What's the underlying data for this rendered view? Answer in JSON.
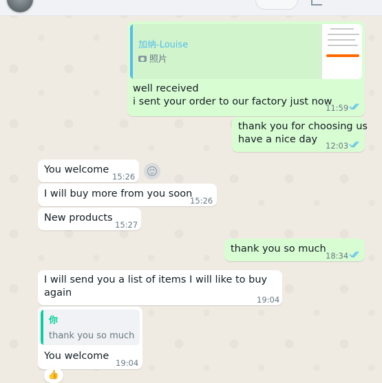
{
  "messages": [
    {
      "id": "m1",
      "direction": "out",
      "quote": {
        "author": "加纳-Louise",
        "subtitle": "照片"
      },
      "lines": [
        "well received",
        "i sent your order to our factory just now"
      ],
      "time": "11:59",
      "read": true
    },
    {
      "id": "m2",
      "direction": "out",
      "lines": [
        "thank you for choosing us",
        "have a nice day"
      ],
      "time": "12:03",
      "read": true
    },
    {
      "id": "m3",
      "direction": "in",
      "lines": [
        "You welcome"
      ],
      "time": "15:26"
    },
    {
      "id": "m4",
      "direction": "in",
      "lines": [
        "I will buy more from you soon"
      ],
      "time": "15:26"
    },
    {
      "id": "m5",
      "direction": "in",
      "lines": [
        "New products"
      ],
      "time": "15:27"
    },
    {
      "id": "m6",
      "direction": "out",
      "lines": [
        "thank you so much"
      ],
      "time": "18:34",
      "read": true
    },
    {
      "id": "m7",
      "direction": "in",
      "lines": [
        "I will send you a list of items I will like to buy",
        "again"
      ],
      "time": "19:04"
    },
    {
      "id": "m8",
      "direction": "in",
      "quote": {
        "author": "你",
        "text": "thank you so much"
      },
      "lines": [
        "You welcome"
      ],
      "time": "19:04",
      "reaction": "👍"
    }
  ],
  "colors": {
    "outgoing_bubble": "#d9fdd3",
    "incoming_bubble": "#ffffff",
    "chat_background": "#efeae2",
    "read_ticks": "#53bdeb",
    "quote_author_out": "#53bdeb",
    "quote_author_in": "#06cf9c"
  },
  "icons": {
    "read_receipt": "double-check-icon",
    "photo": "camera-icon",
    "emoji": "smiley-icon",
    "reaction": "thumbs-up-icon"
  }
}
